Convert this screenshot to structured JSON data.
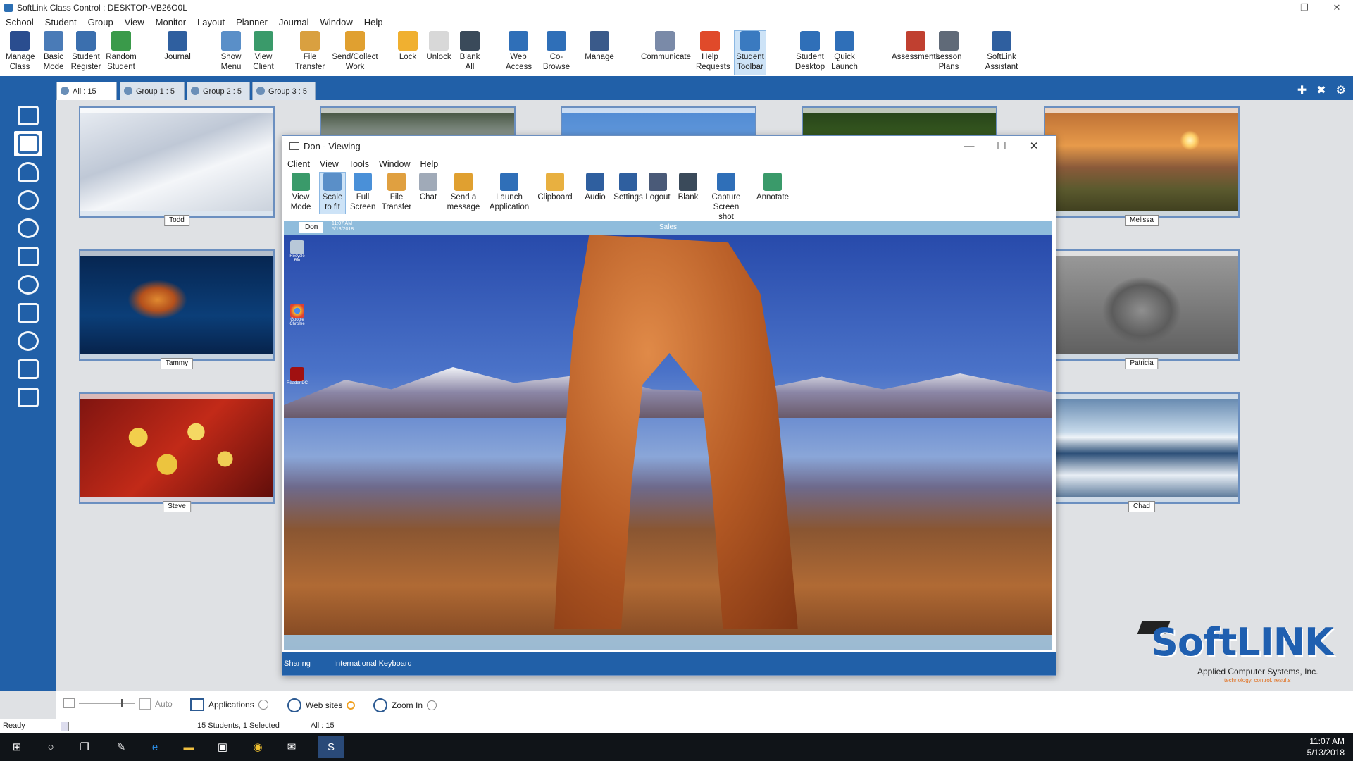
{
  "window": {
    "title": "SoftLink Class Control : DESKTOP-VB26O0L"
  },
  "menu": [
    "School",
    "Student",
    "Group",
    "View",
    "Monitor",
    "Layout",
    "Planner",
    "Journal",
    "Window",
    "Help"
  ],
  "ribbon": [
    {
      "line1": "Manage",
      "line2": "Class",
      "icon": "manage-class-icon",
      "color": "#2a4d8f"
    },
    {
      "line1": "Basic",
      "line2": "Mode",
      "icon": "basic-mode-icon",
      "color": "#4a7bb7"
    },
    {
      "line1": "Student",
      "line2": "Register",
      "icon": "student-register-icon",
      "color": "#3b6fae"
    },
    {
      "line1": "Random",
      "line2": "Student",
      "icon": "random-student-icon",
      "color": "#3a9a4a"
    },
    {
      "line1": "Journal",
      "line2": "",
      "icon": "journal-icon",
      "color": "#2f5f9f"
    },
    {
      "line1": "Show",
      "line2": "Menu",
      "icon": "show-menu-icon",
      "color": "#5a8fc8"
    },
    {
      "line1": "View",
      "line2": "Client",
      "icon": "view-client-icon",
      "color": "#3a9a6a"
    },
    {
      "line1": "File",
      "line2": "Transfer",
      "icon": "file-transfer-icon",
      "color": "#d9a040"
    },
    {
      "line1": "Send/Collect",
      "line2": "Work",
      "icon": "send-collect-icon",
      "color": "#e0a030"
    },
    {
      "line1": "Lock",
      "line2": "",
      "icon": "lock-icon",
      "color": "#f0b030"
    },
    {
      "line1": "Unlock",
      "line2": "",
      "icon": "unlock-icon",
      "color": "#d8d8d8"
    },
    {
      "line1": "Blank",
      "line2": "All",
      "icon": "blank-all-icon",
      "color": "#3a4a5a"
    },
    {
      "line1": "Web",
      "line2": "Access",
      "icon": "web-access-icon",
      "color": "#2f6fb8"
    },
    {
      "line1": "Co-Browse",
      "line2": "",
      "icon": "co-browse-icon",
      "color": "#2f6fb8"
    },
    {
      "line1": "Manage",
      "line2": "",
      "icon": "manage-icon",
      "color": "#3a5a8a"
    },
    {
      "line1": "Communicate",
      "line2": "",
      "icon": "communicate-icon",
      "color": "#7a8aa8"
    },
    {
      "line1": "Help",
      "line2": "Requests",
      "icon": "help-requests-icon",
      "color": "#e04a2a"
    },
    {
      "line1": "Student",
      "line2": "Toolbar",
      "icon": "student-toolbar-icon",
      "color": "#3a7ac0"
    },
    {
      "line1": "Student",
      "line2": "Desktop",
      "icon": "student-desktop-icon",
      "color": "#2f6fb8"
    },
    {
      "line1": "Quick",
      "line2": "Launch",
      "icon": "quick-launch-icon",
      "color": "#2f6fb8"
    },
    {
      "line1": "Assessments",
      "line2": "",
      "icon": "assessments-icon",
      "color": "#c04030"
    },
    {
      "line1": "Lesson",
      "line2": "Plans",
      "icon": "lesson-plans-icon",
      "color": "#606a78"
    },
    {
      "line1": "SoftLink",
      "line2": "Assistant",
      "icon": "softlink-assistant-icon",
      "color": "#2f5f9f"
    }
  ],
  "tabs": [
    {
      "label": "All : 15",
      "selected": true
    },
    {
      "label": "Group 1 : 5",
      "selected": false
    },
    {
      "label": "Group 2 : 5",
      "selected": false
    },
    {
      "label": "Group 3 : 5",
      "selected": false
    }
  ],
  "thumbnails": [
    {
      "name": "Todd",
      "img": "img-todd"
    },
    {
      "name": "",
      "img": "img-t2"
    },
    {
      "name": "",
      "img": "img-t3"
    },
    {
      "name": "",
      "img": "img-t4"
    },
    {
      "name": "Melissa",
      "img": "img-melissa"
    },
    {
      "name": "Tammy",
      "img": "img-tammy"
    },
    {
      "name": "Patricia",
      "img": "img-patricia"
    },
    {
      "name": "Steve",
      "img": "img-steve"
    },
    {
      "name": "Chad",
      "img": "img-chad"
    }
  ],
  "viewer": {
    "title": "Don - Viewing",
    "menu": [
      "Client",
      "View",
      "Tools",
      "Window",
      "Help"
    ],
    "toolbar": [
      {
        "line1": "View",
        "line2": "Mode",
        "icon": "view-mode-icon",
        "color": "#3a9a6a"
      },
      {
        "line1": "Scale",
        "line2": "to fit",
        "icon": "scale-to-fit-icon",
        "color": "#5a8fc8",
        "active": true
      },
      {
        "line1": "Full",
        "line2": "Screen",
        "icon": "full-screen-icon",
        "color": "#4a90d8"
      },
      {
        "line1": "File",
        "line2": "Transfer",
        "icon": "file-transfer-icon",
        "color": "#e0a040"
      },
      {
        "line1": "Chat",
        "line2": "",
        "icon": "chat-icon",
        "color": "#a0aab8"
      },
      {
        "line1": "Send a",
        "line2": "message",
        "icon": "send-message-icon",
        "color": "#e0a030"
      },
      {
        "line1": "Launch",
        "line2": "Application",
        "icon": "launch-application-icon",
        "color": "#2f6fb8"
      },
      {
        "line1": "Clipboard",
        "line2": "",
        "icon": "clipboard-icon",
        "color": "#e8b040"
      },
      {
        "line1": "Audio",
        "line2": "",
        "icon": "audio-icon",
        "color": "#2f5f9f"
      },
      {
        "line1": "Settings",
        "line2": "",
        "icon": "settings-icon",
        "color": "#2f5f9f"
      },
      {
        "line1": "Logout",
        "line2": "",
        "icon": "logout-icon",
        "color": "#4a5a78"
      },
      {
        "line1": "Blank",
        "line2": "",
        "icon": "blank-icon",
        "color": "#3a4a5a"
      },
      {
        "line1": "Capture",
        "line2": "Screen shot",
        "icon": "capture-icon",
        "color": "#2f6fb8"
      },
      {
        "line1": "Annotate",
        "line2": "",
        "icon": "annotate-icon",
        "color": "#3a9a6a"
      }
    ],
    "screen": {
      "tag": "Don",
      "time": "11:07 AM",
      "date": "5/13/2018",
      "group": "Sales",
      "desktop_icons": [
        "Recycle Bin",
        "Google Chrome",
        "Reader DC"
      ]
    },
    "status_sharing": "Sharing",
    "status_keyboard": "International Keyboard"
  },
  "bottom": {
    "auto": "Auto",
    "applications": "Applications",
    "websites": "Web sites",
    "zoom": "Zoom In"
  },
  "status": {
    "ready": "Ready",
    "students": "15 Students, 1 Selected",
    "all": "All : 15"
  },
  "logo": {
    "name": "SoftLINK",
    "company": "Applied Computer Systems, Inc.",
    "tagline": "technology. control. results"
  },
  "clock": {
    "time": "11:07 AM",
    "date": "5/13/2018"
  }
}
